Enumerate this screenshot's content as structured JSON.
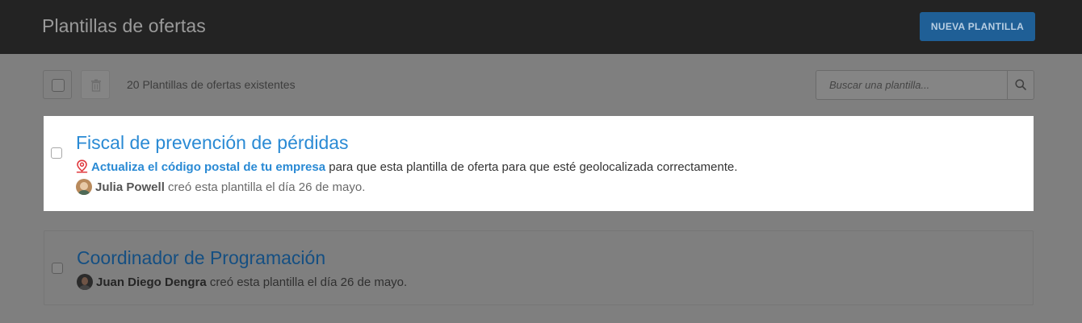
{
  "header": {
    "title": "Plantillas de ofertas",
    "new_button_label": "NUEVA PLANTILLA"
  },
  "toolbar": {
    "count_text": "20 Plantillas de ofertas existentes",
    "search_placeholder": "Buscar una plantilla...",
    "icons": [
      "checkbox",
      "trash-icon",
      "search-icon"
    ]
  },
  "templates": [
    {
      "title": "Fiscal de prevención de pérdidas",
      "notice_link": "Actualiza el código postal de tu empresa",
      "notice_text": " para que esta plantilla de oferta para que esté geolocalizada correctamente.",
      "author": "Julia Powell",
      "created_text": " creó esta plantilla el día 26 de mayo.",
      "icons": [
        "map-pin-icon",
        "avatar"
      ]
    },
    {
      "title": "Coordinador de Programación",
      "author": "Juan Diego Dengra",
      "created_text": " creó esta plantilla el día 26 de mayo.",
      "icons": [
        "avatar"
      ]
    }
  ],
  "colors": {
    "accent": "#2a8ad4",
    "topbar": "#232323",
    "overlay": "#7f7f7f",
    "notice_pin": "#e0393e",
    "button": "#1f5f96"
  }
}
